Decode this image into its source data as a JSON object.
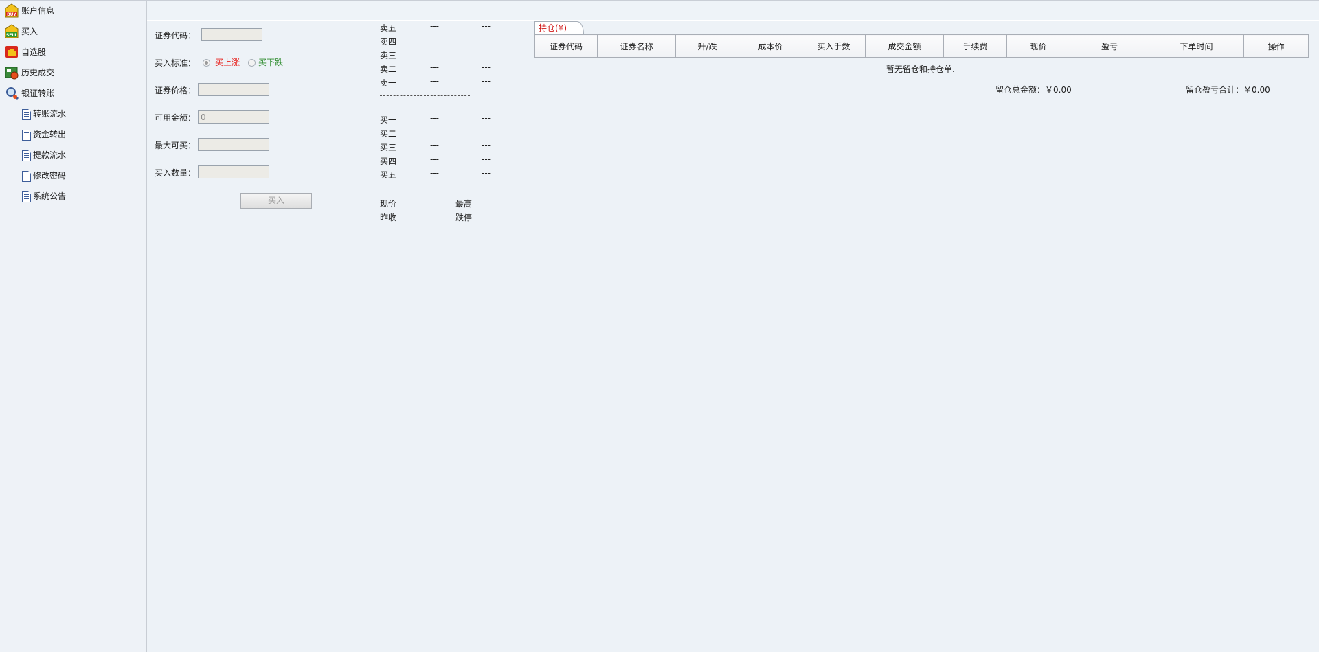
{
  "sidebar": {
    "items": [
      {
        "label": "账户信息",
        "icon": "buy-badge-icon"
      },
      {
        "label": "买入",
        "icon": "sell-badge-icon"
      },
      {
        "label": "自选股",
        "icon": "hand-icon"
      },
      {
        "label": "历史成交",
        "icon": "history-icon"
      },
      {
        "label": "银证转账",
        "icon": "magnifier-icon"
      },
      {
        "label": "转账流水",
        "icon": "document-icon"
      },
      {
        "label": "资金转出",
        "icon": "document-icon"
      },
      {
        "label": "提款流水",
        "icon": "document-icon"
      },
      {
        "label": "修改密码",
        "icon": "document-icon"
      },
      {
        "label": "系统公告",
        "icon": "document-icon"
      }
    ]
  },
  "form": {
    "code_label": "证券代码：",
    "standard_label": "买入标准：",
    "option_up": "买上涨",
    "option_down": "买下跌",
    "price_label": "证券价格：",
    "available_label": "可用金额：",
    "available_value": "0",
    "max_label": "最大可买：",
    "qty_label": "买入数量：",
    "buy_button": "买入",
    "color_up": "#e8231f",
    "color_down": "#2a8a2a"
  },
  "orderbook": {
    "sell": [
      {
        "label": "卖五",
        "price": "---",
        "vol": "---"
      },
      {
        "label": "卖四",
        "price": "---",
        "vol": "---"
      },
      {
        "label": "卖三",
        "price": "---",
        "vol": "---"
      },
      {
        "label": "卖二",
        "price": "---",
        "vol": "---"
      },
      {
        "label": "卖一",
        "price": "---",
        "vol": "---"
      }
    ],
    "buy": [
      {
        "label": "买一",
        "price": "---",
        "vol": "---"
      },
      {
        "label": "买二",
        "price": "---",
        "vol": "---"
      },
      {
        "label": "买三",
        "price": "---",
        "vol": "---"
      },
      {
        "label": "买四",
        "price": "---",
        "vol": "---"
      },
      {
        "label": "买五",
        "price": "---",
        "vol": "---"
      }
    ],
    "separator": "--------------------------------",
    "stats": [
      {
        "label": "现价",
        "value": "---"
      },
      {
        "label": "最高",
        "value": "---"
      },
      {
        "label": "昨收",
        "value": "---"
      },
      {
        "label": "跌停",
        "value": "---"
      }
    ]
  },
  "holdings": {
    "tab_label": "持仓(¥)",
    "columns": [
      "证券代码",
      "证券名称",
      "升/跌",
      "成本价",
      "买入手数",
      "成交金额",
      "手续费",
      "现价",
      "盈亏",
      "下单时间",
      "操作"
    ],
    "empty_text": "暂无留仓和持仓单.",
    "total_amount": "留仓总金额：￥0.00",
    "total_pnl": "留仓盈亏合计：￥0.00"
  }
}
